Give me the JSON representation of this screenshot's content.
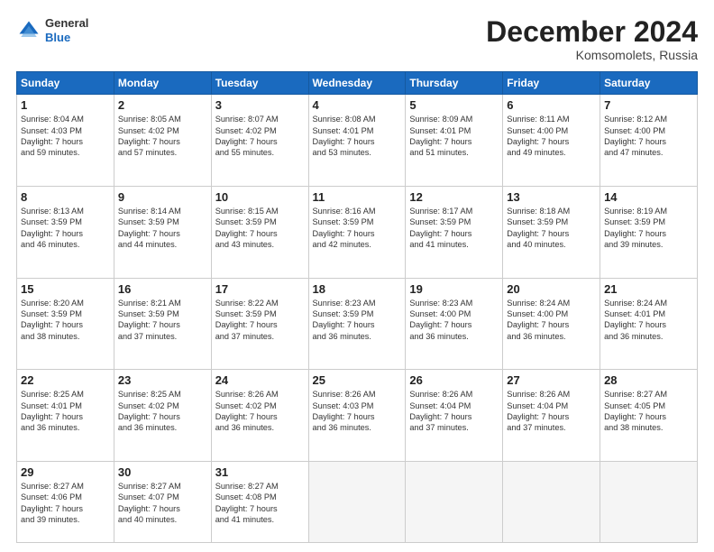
{
  "header": {
    "logo_line1": "General",
    "logo_line2": "Blue",
    "month": "December 2024",
    "location": "Komsomolets, Russia"
  },
  "weekdays": [
    "Sunday",
    "Monday",
    "Tuesday",
    "Wednesday",
    "Thursday",
    "Friday",
    "Saturday"
  ],
  "weeks": [
    [
      {
        "day": "1",
        "info": "Sunrise: 8:04 AM\nSunset: 4:03 PM\nDaylight: 7 hours\nand 59 minutes."
      },
      {
        "day": "2",
        "info": "Sunrise: 8:05 AM\nSunset: 4:02 PM\nDaylight: 7 hours\nand 57 minutes."
      },
      {
        "day": "3",
        "info": "Sunrise: 8:07 AM\nSunset: 4:02 PM\nDaylight: 7 hours\nand 55 minutes."
      },
      {
        "day": "4",
        "info": "Sunrise: 8:08 AM\nSunset: 4:01 PM\nDaylight: 7 hours\nand 53 minutes."
      },
      {
        "day": "5",
        "info": "Sunrise: 8:09 AM\nSunset: 4:01 PM\nDaylight: 7 hours\nand 51 minutes."
      },
      {
        "day": "6",
        "info": "Sunrise: 8:11 AM\nSunset: 4:00 PM\nDaylight: 7 hours\nand 49 minutes."
      },
      {
        "day": "7",
        "info": "Sunrise: 8:12 AM\nSunset: 4:00 PM\nDaylight: 7 hours\nand 47 minutes."
      }
    ],
    [
      {
        "day": "8",
        "info": "Sunrise: 8:13 AM\nSunset: 3:59 PM\nDaylight: 7 hours\nand 46 minutes."
      },
      {
        "day": "9",
        "info": "Sunrise: 8:14 AM\nSunset: 3:59 PM\nDaylight: 7 hours\nand 44 minutes."
      },
      {
        "day": "10",
        "info": "Sunrise: 8:15 AM\nSunset: 3:59 PM\nDaylight: 7 hours\nand 43 minutes."
      },
      {
        "day": "11",
        "info": "Sunrise: 8:16 AM\nSunset: 3:59 PM\nDaylight: 7 hours\nand 42 minutes."
      },
      {
        "day": "12",
        "info": "Sunrise: 8:17 AM\nSunset: 3:59 PM\nDaylight: 7 hours\nand 41 minutes."
      },
      {
        "day": "13",
        "info": "Sunrise: 8:18 AM\nSunset: 3:59 PM\nDaylight: 7 hours\nand 40 minutes."
      },
      {
        "day": "14",
        "info": "Sunrise: 8:19 AM\nSunset: 3:59 PM\nDaylight: 7 hours\nand 39 minutes."
      }
    ],
    [
      {
        "day": "15",
        "info": "Sunrise: 8:20 AM\nSunset: 3:59 PM\nDaylight: 7 hours\nand 38 minutes."
      },
      {
        "day": "16",
        "info": "Sunrise: 8:21 AM\nSunset: 3:59 PM\nDaylight: 7 hours\nand 37 minutes."
      },
      {
        "day": "17",
        "info": "Sunrise: 8:22 AM\nSunset: 3:59 PM\nDaylight: 7 hours\nand 37 minutes."
      },
      {
        "day": "18",
        "info": "Sunrise: 8:23 AM\nSunset: 3:59 PM\nDaylight: 7 hours\nand 36 minutes."
      },
      {
        "day": "19",
        "info": "Sunrise: 8:23 AM\nSunset: 4:00 PM\nDaylight: 7 hours\nand 36 minutes."
      },
      {
        "day": "20",
        "info": "Sunrise: 8:24 AM\nSunset: 4:00 PM\nDaylight: 7 hours\nand 36 minutes."
      },
      {
        "day": "21",
        "info": "Sunrise: 8:24 AM\nSunset: 4:01 PM\nDaylight: 7 hours\nand 36 minutes."
      }
    ],
    [
      {
        "day": "22",
        "info": "Sunrise: 8:25 AM\nSunset: 4:01 PM\nDaylight: 7 hours\nand 36 minutes."
      },
      {
        "day": "23",
        "info": "Sunrise: 8:25 AM\nSunset: 4:02 PM\nDaylight: 7 hours\nand 36 minutes."
      },
      {
        "day": "24",
        "info": "Sunrise: 8:26 AM\nSunset: 4:02 PM\nDaylight: 7 hours\nand 36 minutes."
      },
      {
        "day": "25",
        "info": "Sunrise: 8:26 AM\nSunset: 4:03 PM\nDaylight: 7 hours\nand 36 minutes."
      },
      {
        "day": "26",
        "info": "Sunrise: 8:26 AM\nSunset: 4:04 PM\nDaylight: 7 hours\nand 37 minutes."
      },
      {
        "day": "27",
        "info": "Sunrise: 8:26 AM\nSunset: 4:04 PM\nDaylight: 7 hours\nand 37 minutes."
      },
      {
        "day": "28",
        "info": "Sunrise: 8:27 AM\nSunset: 4:05 PM\nDaylight: 7 hours\nand 38 minutes."
      }
    ],
    [
      {
        "day": "29",
        "info": "Sunrise: 8:27 AM\nSunset: 4:06 PM\nDaylight: 7 hours\nand 39 minutes."
      },
      {
        "day": "30",
        "info": "Sunrise: 8:27 AM\nSunset: 4:07 PM\nDaylight: 7 hours\nand 40 minutes."
      },
      {
        "day": "31",
        "info": "Sunrise: 8:27 AM\nSunset: 4:08 PM\nDaylight: 7 hours\nand 41 minutes."
      },
      {
        "day": "",
        "info": ""
      },
      {
        "day": "",
        "info": ""
      },
      {
        "day": "",
        "info": ""
      },
      {
        "day": "",
        "info": ""
      }
    ]
  ]
}
